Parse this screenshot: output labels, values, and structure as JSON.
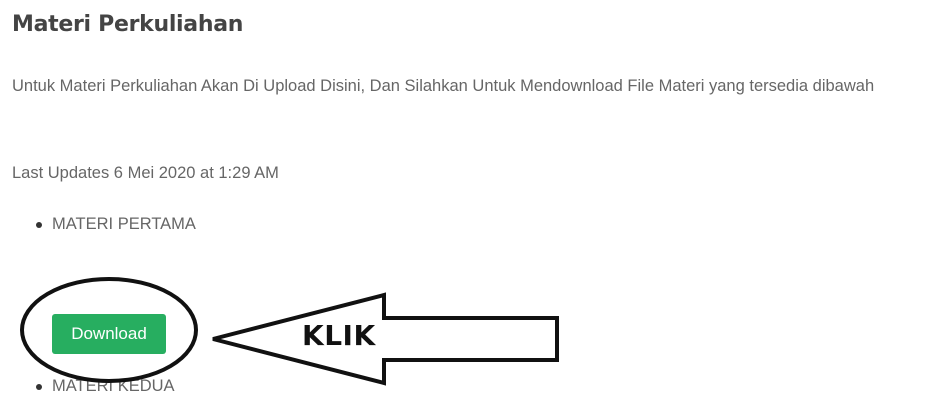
{
  "page": {
    "title": "Materi Perkuliahan",
    "intro": "Untuk Materi Perkuliahan Akan Di Upload Disini, Dan Silahkan Untuk Mendownload File Materi yang tersedia dibawah",
    "last_updated": "Last Updates 6 Mei 2020 at 1:29 AM"
  },
  "materials": [
    {
      "label": "MATERI PERTAMA"
    },
    {
      "label": "MATERI KEDUA"
    }
  ],
  "download": {
    "label": "Download"
  },
  "annotation": {
    "text": "KLIK"
  },
  "colors": {
    "button": "#27ae60",
    "text": "#666666",
    "title": "#444444",
    "annotation": "#111111"
  }
}
